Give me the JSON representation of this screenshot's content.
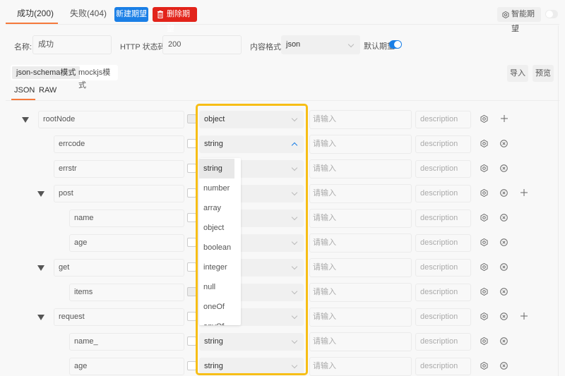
{
  "tabs": [
    {
      "label": "成功(200)",
      "active": true
    },
    {
      "label": "失败(404)",
      "active": false
    }
  ],
  "toolbar": {
    "new_label": "新建期望",
    "delete_label": "删除期望",
    "smart_label": "智能期望",
    "smart_enabled": false
  },
  "form": {
    "name_label": "名称:",
    "name_value": "成功",
    "status_label": "HTTP 状态码:",
    "status_value": "200",
    "format_label": "内容格式:",
    "format_value": "json",
    "default_label": "默认期望",
    "default_enabled": true
  },
  "modes": [
    {
      "label": "json-schema模式",
      "active": true
    },
    {
      "label": "mockjs模式",
      "active": false
    }
  ],
  "actions": {
    "import_label": "导入",
    "preview_label": "预览"
  },
  "subtabs": [
    {
      "label": "JSON",
      "active": true
    },
    {
      "label": "RAW",
      "active": false
    }
  ],
  "tree": {
    "mock_placeholder": "请输入",
    "desc_placeholder": "description",
    "rows": [
      {
        "name": "rootNode",
        "type": "object",
        "expandable": true,
        "required_disabled": true
      },
      {
        "name": "errcode",
        "type": "string",
        "dropdown_open": true
      },
      {
        "name": "errstr",
        "type": ""
      },
      {
        "name": "post",
        "type": "",
        "expandable": true
      },
      {
        "name": "name",
        "type": ""
      },
      {
        "name": "age",
        "type": ""
      },
      {
        "name": "get",
        "type": "",
        "expandable": true
      },
      {
        "name": "items",
        "type": "",
        "required_disabled": true
      },
      {
        "name": "request",
        "type": "",
        "expandable": true
      },
      {
        "name": "name_",
        "type": "string"
      },
      {
        "name": "age",
        "type": "string"
      }
    ]
  },
  "type_dropdown": {
    "selected": "string",
    "options": [
      "string",
      "number",
      "array",
      "object",
      "boolean",
      "integer",
      "null",
      "oneOf",
      "anyOf"
    ]
  },
  "colors": {
    "accent_tab": "#f5793b",
    "primary": "#1a7fe6",
    "danger": "#e2231a",
    "highlight": "#f7be16"
  }
}
